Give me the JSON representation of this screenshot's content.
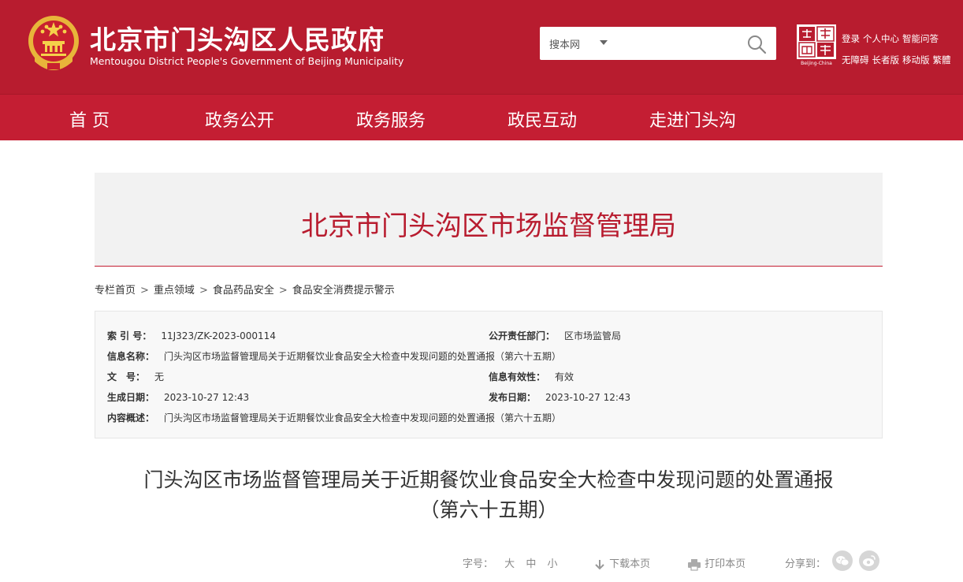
{
  "header": {
    "title": "北京市门头沟区人民政府",
    "subtitle": "Mentougou District People's Government of Beijing Municipality",
    "brand_color": "#b81c2f",
    "search": {
      "scope": "搜本网",
      "placeholder": ""
    },
    "seal_text": "Beijing-China",
    "links_row1": [
      "登录",
      "个人中心",
      "智能问答"
    ],
    "links_row2": [
      "无障碍",
      "长者版",
      "移动版",
      "繁體"
    ]
  },
  "nav": {
    "items": [
      "首 页",
      "政务公开",
      "政务服务",
      "政民互动",
      "走进门头沟"
    ]
  },
  "banner": {
    "title": "北京市门头沟区市场监督管理局"
  },
  "breadcrumb": [
    "专栏首页",
    "重点领域",
    "食品药品安全",
    "食品安全消费提示警示"
  ],
  "breadcrumb_sep": ">",
  "info": {
    "index_label": "索 引 号：",
    "index_value": "11J323/ZK-2023-000114",
    "dept_label": "公开责任部门：",
    "dept_value": "区市场监管局",
    "name_label": "信息名称：",
    "name_value": "门头沟区市场监督管理局关于近期餐饮业食品安全大检查中发现问题的处置通报（第六十五期）",
    "doc_label": "文　号：",
    "doc_value": "无",
    "valid_label": "信息有效性：",
    "valid_value": "有效",
    "created_label": "生成日期：",
    "created_value": "2023-10-27 12:43",
    "published_label": "发布日期：",
    "published_value": "2023-10-27 12:43",
    "summary_label": "内容概述：",
    "summary_value": "门头沟区市场监督管理局关于近期餐饮业食品安全大检查中发现问题的处置通报（第六十五期）"
  },
  "article": {
    "title_line1": "门头沟区市场监督管理局关于近期餐饮业食品安全大检查中发现问题的处置通报",
    "title_line2": "（第六十五期）"
  },
  "tools": {
    "font_label": "字号：",
    "font_large": "大",
    "font_medium": "中",
    "font_small": "小",
    "download": "下载本页",
    "print": "打印本页",
    "share": "分享到："
  }
}
